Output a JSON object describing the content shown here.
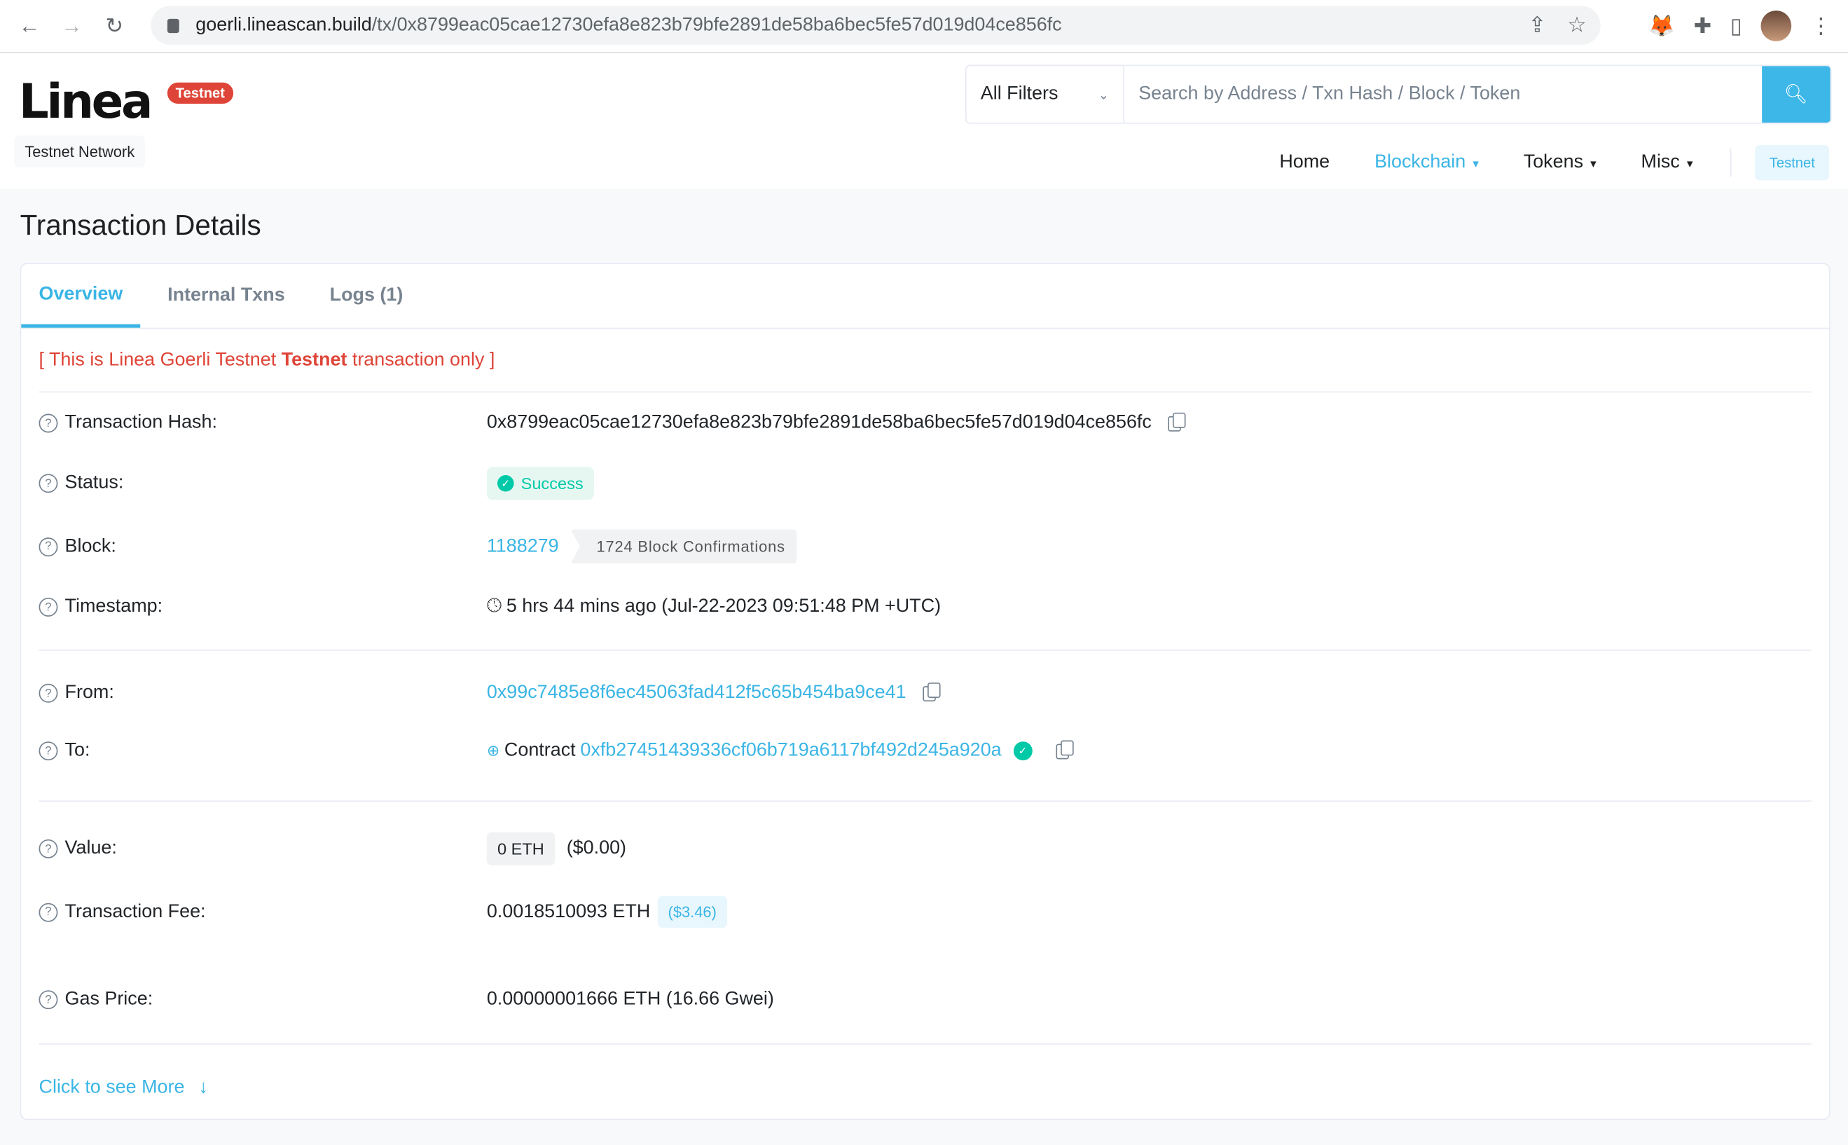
{
  "browser": {
    "url_host": "goerli.lineascan.build",
    "url_path": "/tx/0x8799eac05cae12730efa8e823b79bfe2891de58ba6bec5fe57d019d04ce856fc"
  },
  "header": {
    "logo": "Linea",
    "logo_badge": "Testnet",
    "network_label": "Testnet Network",
    "search": {
      "filter": "All Filters",
      "placeholder": "Search by Address / Txn Hash / Block / Token"
    },
    "nav": [
      {
        "label": "Home"
      },
      {
        "label": "Blockchain",
        "active": true
      },
      {
        "label": "Tokens"
      },
      {
        "label": "Misc"
      }
    ],
    "network_button": "Testnet"
  },
  "page_title": "Transaction Details",
  "tabs": [
    "Overview",
    "Internal Txns",
    "Logs (1)"
  ],
  "notice": {
    "prefix": "[ This is Linea Goerli Testnet ",
    "bold": "Testnet",
    "suffix": " transaction only ]"
  },
  "details": {
    "hash": {
      "label": "Transaction Hash:",
      "value": "0x8799eac05cae12730efa8e823b79bfe2891de58ba6bec5fe57d019d04ce856fc"
    },
    "status": {
      "label": "Status:",
      "value": "Success"
    },
    "block": {
      "label": "Block:",
      "value": "1188279",
      "confirmations": "1724 Block Confirmations"
    },
    "timestamp": {
      "label": "Timestamp:",
      "value": "5 hrs 44 mins ago (Jul-22-2023 09:51:48 PM +UTC)"
    },
    "from": {
      "label": "From:",
      "value": "0x99c7485e8f6ec45063fad412f5c65b454ba9ce41"
    },
    "to": {
      "label": "To:",
      "prefix": "Contract",
      "value": "0xfb27451439336cf06b719a6117bf492d245a920a"
    },
    "value": {
      "label": "Value:",
      "amount": "0 ETH",
      "usd": "($0.00)"
    },
    "fee": {
      "label": "Transaction Fee:",
      "amount": "0.0018510093 ETH",
      "usd": "($3.46)"
    },
    "gas": {
      "label": "Gas Price:",
      "value": "0.00000001666 ETH (16.66 Gwei)"
    }
  },
  "more_link": "Click to see More",
  "colors": {
    "accent": "#3ab5e5",
    "success": "#00c9a7",
    "danger": "#de4437"
  }
}
